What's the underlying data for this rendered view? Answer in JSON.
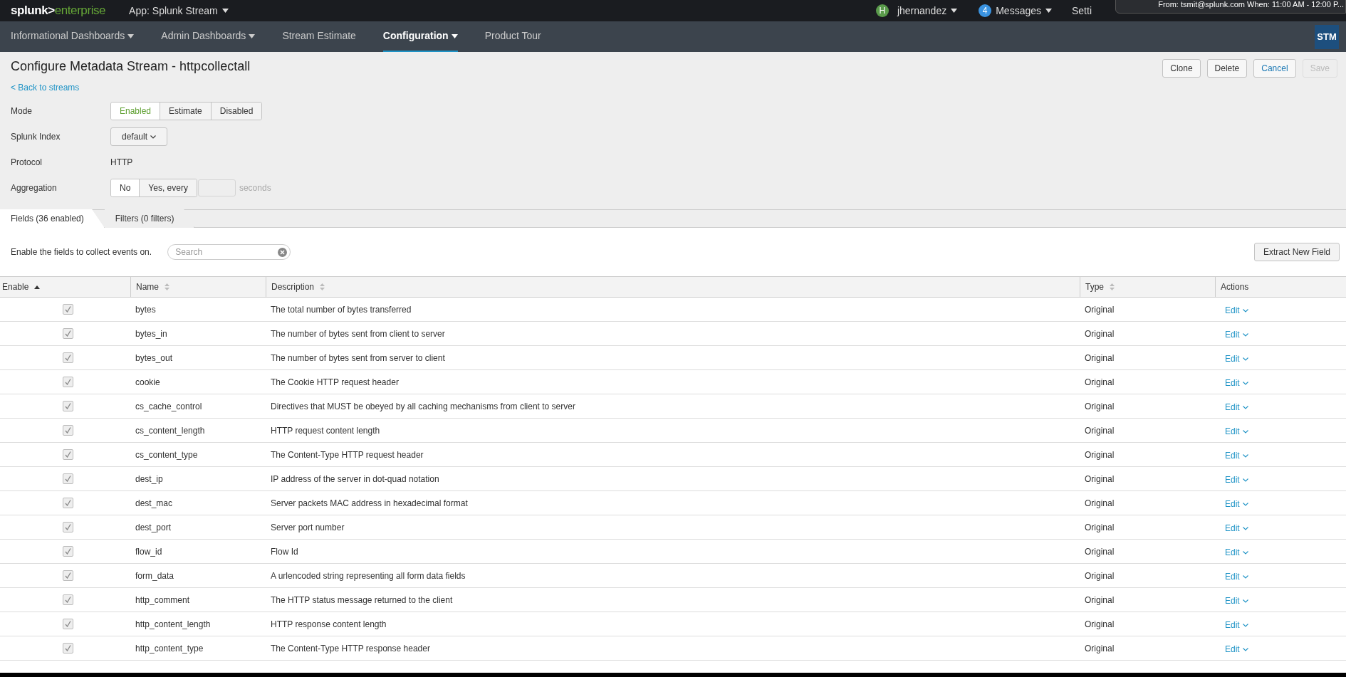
{
  "top_bar": {
    "logo_left": "splunk>",
    "logo_right": "enterprise",
    "app_menu": "App: Splunk Stream",
    "user": {
      "initial": "H",
      "name": "jhernandez"
    },
    "messages": {
      "count": "4",
      "label": "Messages"
    },
    "settings_partial": "Setti",
    "notification": "From: tsmit@splunk.com When: 11:00 AM - 12:00 P..."
  },
  "nav": {
    "items": [
      {
        "label": "Informational Dashboards",
        "dropdown": true,
        "selected": false
      },
      {
        "label": "Admin Dashboards",
        "dropdown": true,
        "selected": false
      },
      {
        "label": "Stream Estimate",
        "dropdown": false,
        "selected": false
      },
      {
        "label": "Configuration",
        "dropdown": true,
        "selected": true
      },
      {
        "label": "Product Tour",
        "dropdown": false,
        "selected": false
      }
    ],
    "app_badge": "STM"
  },
  "page": {
    "title": "Configure Metadata Stream - httpcollectall",
    "back_link": "< Back to streams",
    "actions": [
      {
        "label": "Clone",
        "kind": "default",
        "disabled": false
      },
      {
        "label": "Delete",
        "kind": "default",
        "disabled": false
      },
      {
        "label": "Cancel",
        "kind": "link",
        "disabled": false
      },
      {
        "label": "Save",
        "kind": "default",
        "disabled": true
      }
    ],
    "mode": {
      "label": "Mode",
      "options": [
        {
          "label": "Enabled",
          "selected": true
        },
        {
          "label": "Estimate",
          "selected": false
        },
        {
          "label": "Disabled",
          "selected": false
        }
      ]
    },
    "index": {
      "label": "Splunk Index",
      "value": "default"
    },
    "protocol": {
      "label": "Protocol",
      "value": "HTTP"
    },
    "aggregation": {
      "label": "Aggregation",
      "options": [
        {
          "label": "No",
          "selected": true
        },
        {
          "label": "Yes, every",
          "selected": false
        }
      ],
      "unit": "seconds"
    }
  },
  "tabs": [
    {
      "label": "Fields (36 enabled)",
      "selected": true
    },
    {
      "label": "Filters (0 filters)",
      "selected": false
    }
  ],
  "fields": {
    "hint": "Enable the fields to collect events on.",
    "search": {
      "placeholder": "Search"
    },
    "extract_button": "Extract New Field",
    "columns": [
      {
        "label": "Enable",
        "sortable": true,
        "sorted": true
      },
      {
        "label": "Name",
        "sortable": true,
        "sorted": false
      },
      {
        "label": "Description",
        "sortable": true,
        "sorted": false
      },
      {
        "label": "Type",
        "sortable": true,
        "sorted": false
      },
      {
        "label": "Actions",
        "sortable": false,
        "sorted": false
      }
    ],
    "rows": [
      {
        "checked": true,
        "name": "bytes",
        "description": "The total number of bytes transferred",
        "type": "Original",
        "action": "Edit"
      },
      {
        "checked": true,
        "name": "bytes_in",
        "description": "The number of bytes sent from client to server",
        "type": "Original",
        "action": "Edit"
      },
      {
        "checked": true,
        "name": "bytes_out",
        "description": "The number of bytes sent from server to client",
        "type": "Original",
        "action": "Edit"
      },
      {
        "checked": true,
        "name": "cookie",
        "description": "The Cookie HTTP request header",
        "type": "Original",
        "action": "Edit"
      },
      {
        "checked": true,
        "name": "cs_cache_control",
        "description": "Directives that MUST be obeyed by all caching mechanisms from client to server",
        "type": "Original",
        "action": "Edit"
      },
      {
        "checked": true,
        "name": "cs_content_length",
        "description": "HTTP request content length",
        "type": "Original",
        "action": "Edit"
      },
      {
        "checked": true,
        "name": "cs_content_type",
        "description": "The Content-Type HTTP request header",
        "type": "Original",
        "action": "Edit"
      },
      {
        "checked": true,
        "name": "dest_ip",
        "description": "IP address of the server in dot-quad notation",
        "type": "Original",
        "action": "Edit"
      },
      {
        "checked": true,
        "name": "dest_mac",
        "description": "Server packets MAC address in hexadecimal format",
        "type": "Original",
        "action": "Edit"
      },
      {
        "checked": true,
        "name": "dest_port",
        "description": "Server port number",
        "type": "Original",
        "action": "Edit"
      },
      {
        "checked": true,
        "name": "flow_id",
        "description": "Flow Id",
        "type": "Original",
        "action": "Edit"
      },
      {
        "checked": true,
        "name": "form_data",
        "description": "A urlencoded string representing all form data fields",
        "type": "Original",
        "action": "Edit"
      },
      {
        "checked": true,
        "name": "http_comment",
        "description": "The HTTP status message returned to the client",
        "type": "Original",
        "action": "Edit"
      },
      {
        "checked": true,
        "name": "http_content_length",
        "description": "HTTP response content length",
        "type": "Original",
        "action": "Edit"
      },
      {
        "checked": true,
        "name": "http_content_type",
        "description": "The Content-Type HTTP response header",
        "type": "Original",
        "action": "Edit"
      }
    ]
  }
}
